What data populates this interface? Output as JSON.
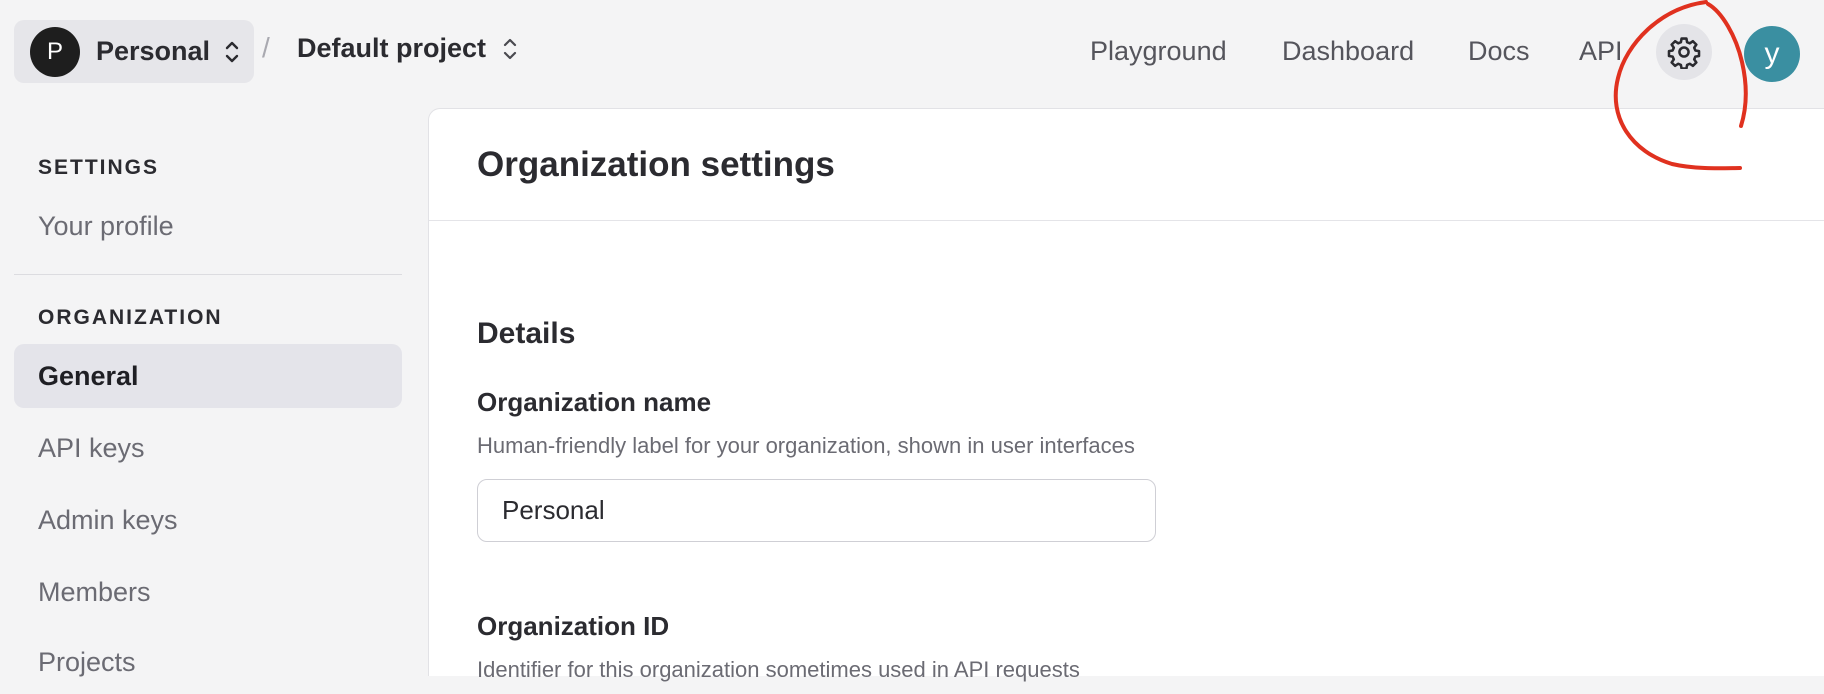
{
  "header": {
    "org_initial": "P",
    "org_name": "Personal",
    "separator": "/",
    "project_name": "Default project",
    "nav": [
      "Playground",
      "Dashboard",
      "Docs",
      "API"
    ],
    "settings_icon": "gear-icon",
    "user_initial": "y",
    "user_avatar_color": "#3a8fa1"
  },
  "sidebar": {
    "settings_heading": "SETTINGS",
    "profile_item": "Your profile",
    "organization_heading": "ORGANIZATION",
    "items": [
      "General",
      "API keys",
      "Admin keys",
      "Members",
      "Projects"
    ],
    "active_item": "General"
  },
  "main": {
    "title": "Organization settings",
    "details_heading": "Details",
    "org_name_label": "Organization name",
    "org_name_help": "Human-friendly label for your organization, shown in user interfaces",
    "org_name_value": "Personal",
    "org_id_label": "Organization ID",
    "org_id_help": "Identifier for this organization sometimes used in API requests"
  },
  "annotation_color": "#e0311f"
}
